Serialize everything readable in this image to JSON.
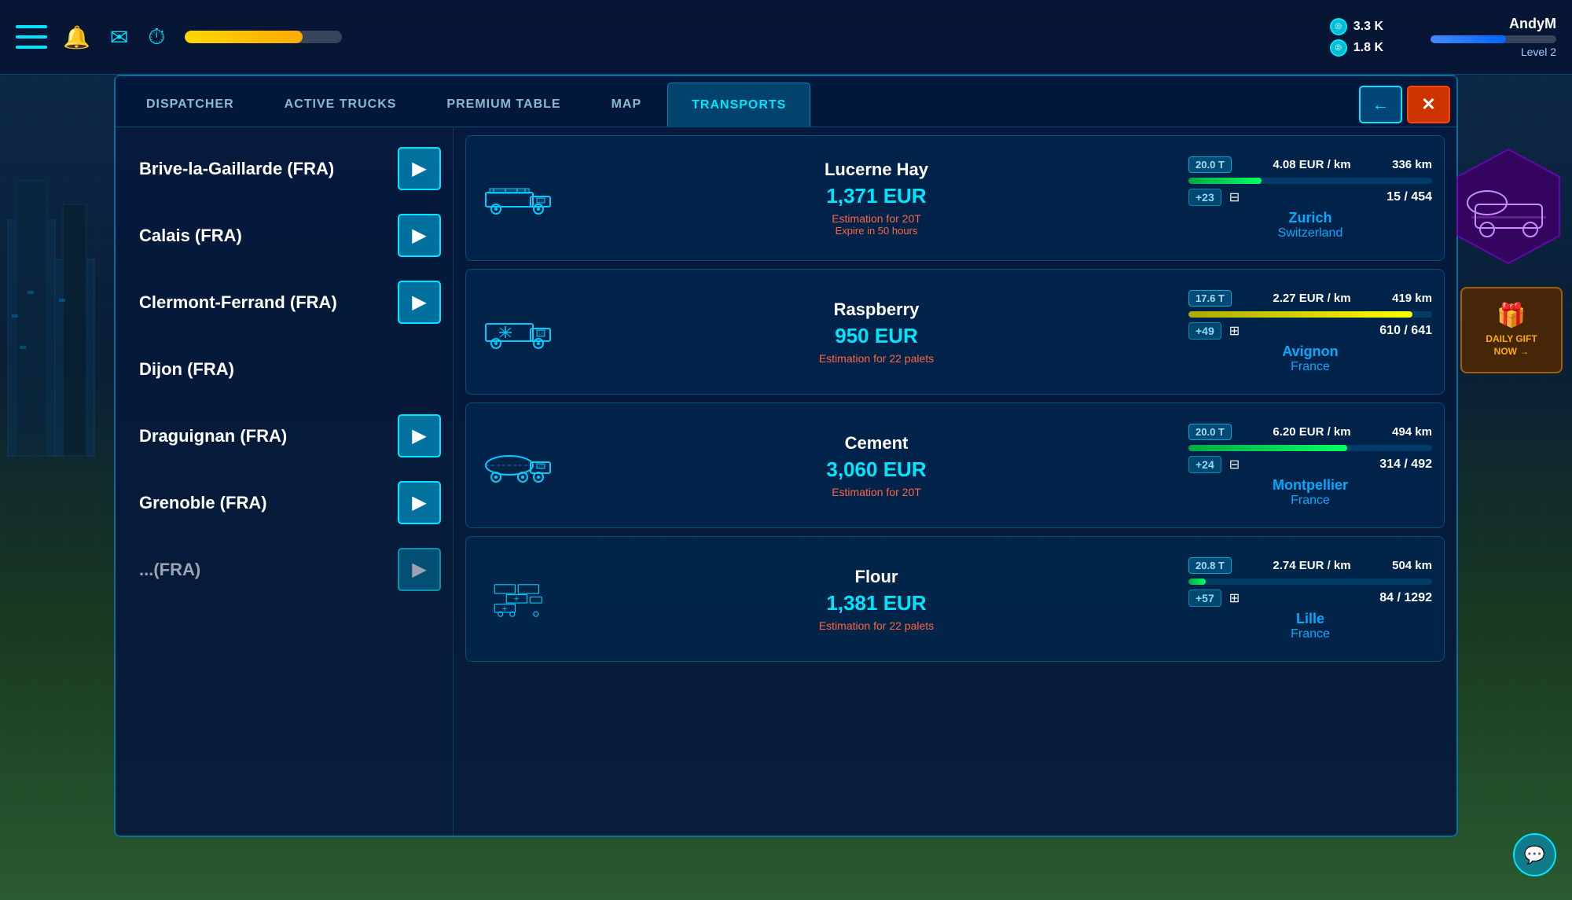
{
  "background": {
    "color": "#0a1a2e"
  },
  "hud": {
    "currency1_value": "3.3 K",
    "currency2_value": "1.8 K",
    "player_name": "AndyM",
    "player_level": "Level 2",
    "xp_percent": 75,
    "level_percent": 60
  },
  "tabs": [
    {
      "id": "dispatcher",
      "label": "DISPATCHER",
      "active": false
    },
    {
      "id": "active-trucks",
      "label": "ACTIVE TRUCKS",
      "active": false
    },
    {
      "id": "premium-table",
      "label": "PREMIUM TABLE",
      "active": false
    },
    {
      "id": "map",
      "label": "MAP",
      "active": false
    },
    {
      "id": "transports",
      "label": "TRANSPORTS",
      "active": true
    }
  ],
  "back_button_label": "←",
  "close_button_label": "✕",
  "cities": [
    {
      "id": "brive",
      "name": "Brive-la-Gaillarde (FRA)",
      "has_arrow": true
    },
    {
      "id": "calais",
      "name": "Calais (FRA)",
      "has_arrow": true
    },
    {
      "id": "clermont",
      "name": "Clermont-Ferrand (FRA)",
      "has_arrow": true
    },
    {
      "id": "dijon",
      "name": "Dijon (FRA)",
      "has_arrow": false
    },
    {
      "id": "draguignan",
      "name": "Draguignan (FRA)",
      "has_arrow": true
    },
    {
      "id": "grenoble",
      "name": "Grenoble (FRA)",
      "has_arrow": true
    },
    {
      "id": "partial",
      "name": "...(FRA)",
      "has_arrow": true
    }
  ],
  "transports": [
    {
      "id": "t1",
      "name": "Lucerne Hay",
      "price": "1,371 EUR",
      "estimation": "Estimation for 20T",
      "extra": "Expire in 50 hours",
      "weight": "20.0 T",
      "rate": "4.08 EUR / km",
      "distance": "336 km",
      "progress_pct": 30,
      "progress_type": "green",
      "bonus": "+23",
      "slot_icon": "⊟",
      "slots": "15 / 454",
      "dest_city": "Zurich",
      "dest_country": "Switzerland",
      "truck_type": "flatbed"
    },
    {
      "id": "t2",
      "name": "Raspberry",
      "price": "950 EUR",
      "estimation": "Estimation for 22 palets",
      "extra": "",
      "weight": "17.6 T",
      "rate": "2.27 EUR / km",
      "distance": "419 km",
      "progress_pct": 92,
      "progress_type": "yellow",
      "bonus": "+49",
      "slot_icon": "⊞",
      "slots": "610 / 641",
      "dest_city": "Avignon",
      "dest_country": "France",
      "truck_type": "refrigerated"
    },
    {
      "id": "t3",
      "name": "Cement",
      "price": "3,060 EUR",
      "estimation": "Estimation for 20T",
      "extra": "",
      "weight": "20.0 T",
      "rate": "6.20 EUR / km",
      "distance": "494 km",
      "progress_pct": 65,
      "progress_type": "green",
      "bonus": "+24",
      "slot_icon": "⊟",
      "slots": "314 / 492",
      "dest_city": "Montpellier",
      "dest_country": "France",
      "truck_type": "tanker"
    },
    {
      "id": "t4",
      "name": "Flour",
      "price": "1,381 EUR",
      "estimation": "Estimation for 22 palets",
      "extra": "",
      "weight": "20.8 T",
      "rate": "2.74 EUR / km",
      "distance": "504 km",
      "progress_pct": 7,
      "progress_type": "green",
      "bonus": "+57",
      "slot_icon": "⊞",
      "slots": "84 / 1292",
      "dest_city": "Lille",
      "dest_country": "France",
      "truck_type": "multi"
    }
  ],
  "daily_gift": {
    "label": "DAILY GIFT\nNOW",
    "arrow": "→"
  },
  "chat_icon": "💬"
}
